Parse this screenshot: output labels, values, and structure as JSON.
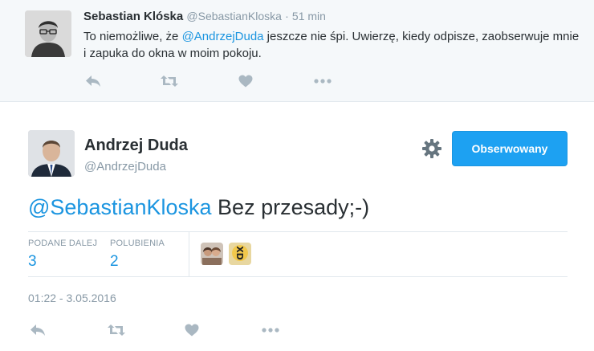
{
  "parent_tweet": {
    "author_name": "Sebastian Klóska",
    "handle": "@SebastianKloska",
    "separator": "·",
    "time_ago": "51 min",
    "text_prefix": "To niemożliwe, że ",
    "mention": "@AndrzejDuda",
    "text_suffix": " jeszcze nie śpi. Uwierzę, kiedy odpisze, zaobserwuje mnie i zapuka do okna w moim pokoju.",
    "actions": [
      "reply-icon",
      "retweet-icon",
      "heart-icon",
      "more-icon"
    ]
  },
  "main_tweet": {
    "author_name": "Andrzej Duda",
    "handle": "@AndrzejDuda",
    "follow_button_label": "Obserwowany",
    "mention": "@SebastianKloska",
    "text": " Bez przesady;-)",
    "retweets_label": "PODANE DALEJ",
    "retweets_count": "3",
    "likes_label": "POLUBIENIA",
    "likes_count": "2",
    "liker_avatars": [
      "avatar-two-people",
      "avatar-xd"
    ],
    "timestamp": "01:22 - 3.05.2016",
    "actions": [
      "reply-icon",
      "retweet-icon",
      "heart-icon",
      "more-icon"
    ]
  },
  "colors": {
    "link": "#1b95e0",
    "button": "#1da1f2",
    "muted": "#8899a6",
    "icon": "#aab8c2",
    "text": "#292f33",
    "parent_bg": "#f5f8fa"
  }
}
